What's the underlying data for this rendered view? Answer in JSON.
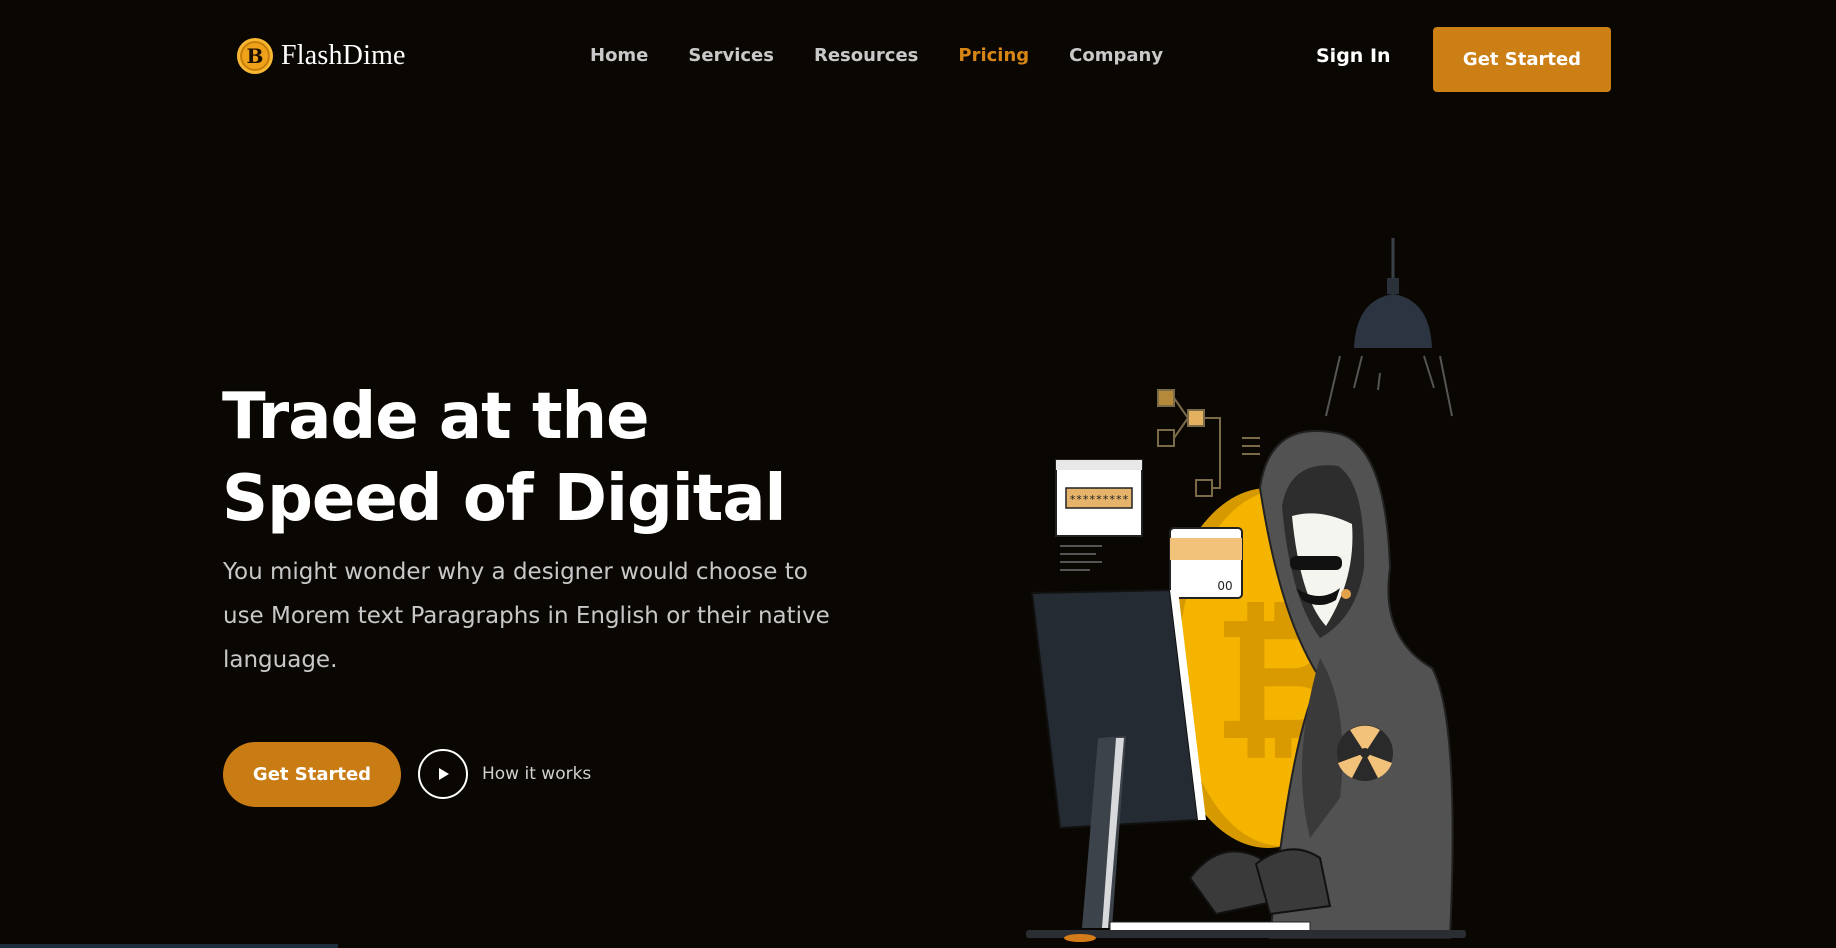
{
  "brand": {
    "name": "FlashDime",
    "coin_symbol": "B"
  },
  "nav": {
    "items": [
      {
        "label": "Home"
      },
      {
        "label": "Services"
      },
      {
        "label": "Resources"
      },
      {
        "label": "Pricing",
        "active": true
      },
      {
        "label": "Company"
      }
    ],
    "active_color": "#d78616"
  },
  "header": {
    "signin_label": "Sign In",
    "cta_label": "Get Started"
  },
  "hero": {
    "title_line1": "Trade at the",
    "title_line2": "Speed of Digital",
    "description": "You might wonder why a designer would choose to use Morem text Paragraphs in English or their native language.",
    "cta_label": "Get Started",
    "secondary_label": "How it works"
  },
  "illustration": {
    "password_field_text": "*********",
    "card_number_text": "00"
  },
  "colors": {
    "accent": "#cc7f14",
    "background": "#0a0703",
    "coin": "#f5b400"
  },
  "icons": [
    "bitcoin-logo-icon",
    "play-icon",
    "hanging-lamp-icon",
    "bitcoin-coin-icon",
    "hacker-illustration"
  ]
}
